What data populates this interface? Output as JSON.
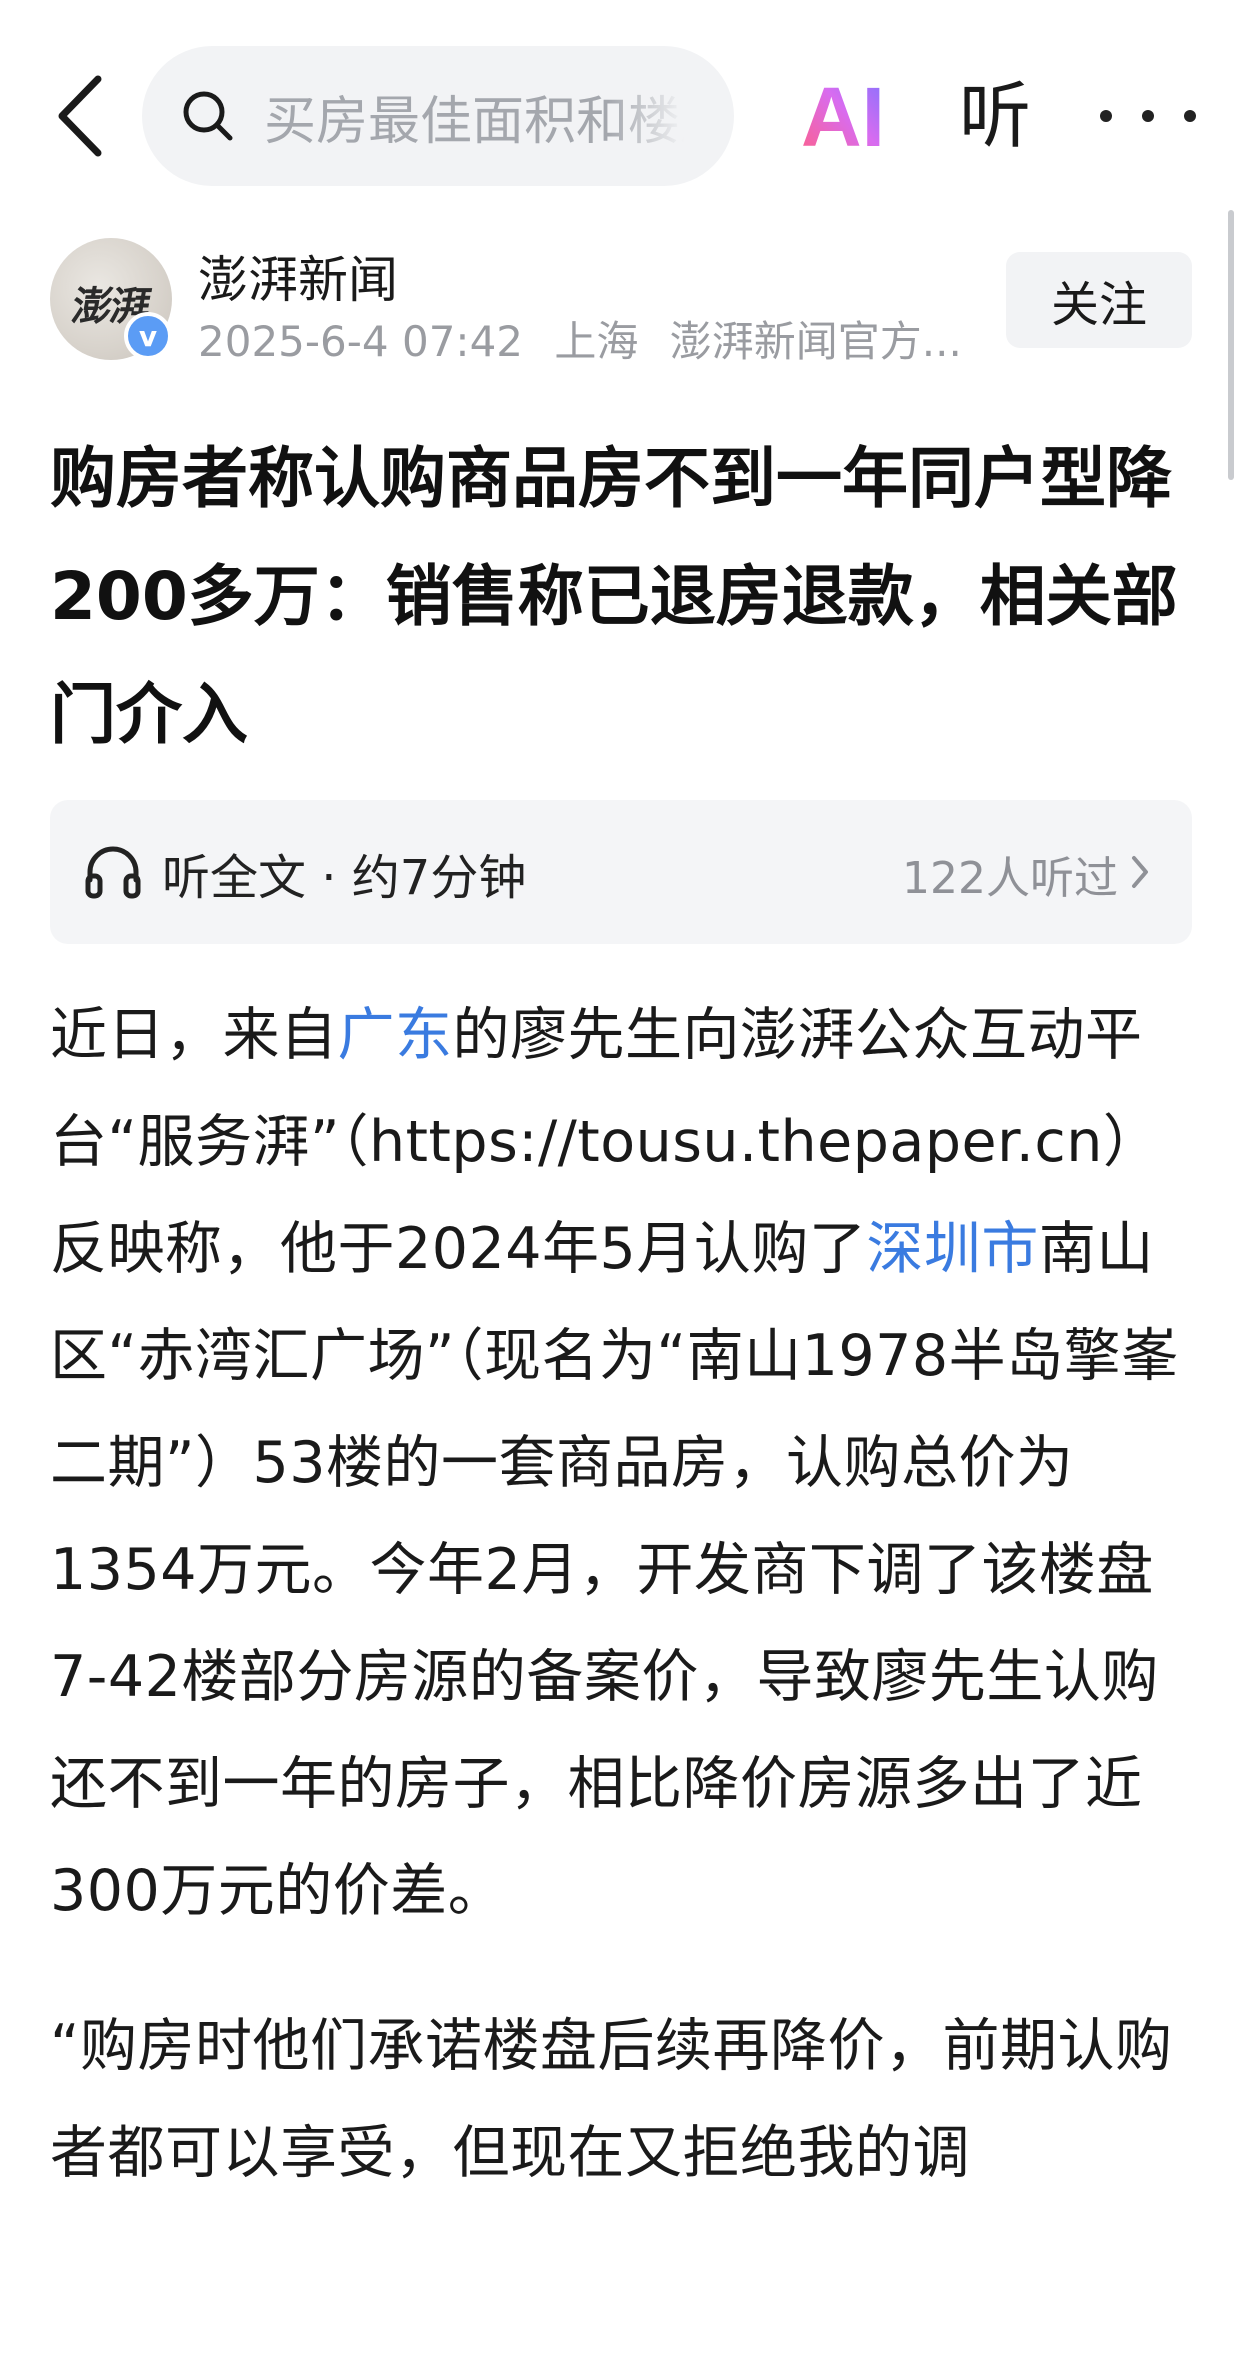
{
  "nav": {
    "search_placeholder": "买房最佳面积和楼层",
    "ai_label": "AI",
    "listen_label": "听"
  },
  "author": {
    "avatar_text": "澎湃",
    "verified_badge": "v",
    "name": "澎湃新闻",
    "date": "2025-6-4 07:42",
    "location": "上海",
    "account_desc": "澎湃新闻官方...",
    "follow_label": "关注"
  },
  "article": {
    "title": "购房者称认购商品房不到一年同户型降200多万：销售称已退房退款，相关部门介入",
    "listen": {
      "label": "听全文 · 约7分钟",
      "count": "122人听过"
    },
    "p1": {
      "t1": "近日，来自",
      "link1": "广东",
      "t2": "的廖先生向澎湃公众互动平台“服务湃”（https://tousu.thepaper.cn）反映称，他于2024年5月认购了",
      "link2": "深圳市",
      "t3": "南山区“赤湾汇广场”（现名为“南山1978半岛擎峯二期”）53楼的一套商品房，认购总价为1354万元。今年2月，开发商下调了该楼盘7-42楼部分房源的备案价，导致廖先生认购还不到一年的房子，相比降价房源多出了近300万元的价差。"
    },
    "p2": "“购房时他们承诺楼盘后续再降价，前期认购者都可以享受，但现在又拒绝我的调"
  },
  "colors": {
    "link": "#3a7be0",
    "ai_gradient_start": "#ff6b8a",
    "ai_gradient_end": "#7b6cff",
    "verified": "#5b9cf5"
  }
}
